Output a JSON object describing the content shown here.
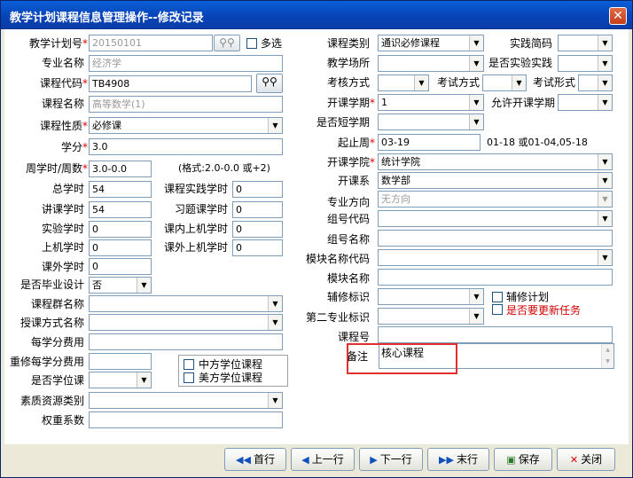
{
  "window": {
    "title": "教学计划课程信息管理操作--修改记录",
    "close": "✕"
  },
  "left": {
    "jxjhh": {
      "label": "教学计划号",
      "value": "20150101"
    },
    "duoxuan": "多选",
    "zymc": {
      "label": "专业名称",
      "value": "经济学"
    },
    "kcdm": {
      "label": "课程代码",
      "value": "TB4908"
    },
    "kcmc": {
      "label": "课程名称",
      "value": "高等数学(1)"
    },
    "kcxz": {
      "label": "课程性质",
      "value": "必修课"
    },
    "xf": {
      "label": "学分",
      "value": "3.0"
    },
    "zxs": {
      "label": "周学时/周数",
      "value": "3.0-0.0",
      "hint": "(格式:2.0-0.0 或+2)"
    },
    "zongxs": {
      "label": "总学时",
      "value": "54"
    },
    "kcsjxs": {
      "label": "课程实践学时",
      "value": "0"
    },
    "jkxs": {
      "label": "讲课学时",
      "value": "54"
    },
    "xtkxs": {
      "label": "习题课学时",
      "value": "0"
    },
    "syxs": {
      "label": "实验学时",
      "value": "0"
    },
    "knsjxs": {
      "label": "课内上机学时",
      "value": "0"
    },
    "sjxs": {
      "label": "上机学时",
      "value": "0"
    },
    "kwsjxs": {
      "label": "课外上机学时",
      "value": "0"
    },
    "kwxs": {
      "label": "课外学时",
      "value": "0"
    },
    "sfbysj": {
      "label": "是否毕业设计",
      "value": "否"
    },
    "kcqmc": {
      "label": "课程群名称",
      "value": ""
    },
    "skfsmc": {
      "label": "授课方式名称",
      "value": ""
    },
    "mxffy": {
      "label": "每学分费用",
      "value": ""
    },
    "cxmxffy": {
      "label": "重修每学分费用",
      "value": ""
    },
    "sfxwk": {
      "label": "是否学位课",
      "value": ""
    },
    "zfxwkc": "中方学位课程",
    "mfxwkc": "美方学位课程",
    "szzylb": {
      "label": "素质资源类别",
      "value": ""
    },
    "qzxs": {
      "label": "权重系数",
      "value": ""
    }
  },
  "right": {
    "kclb": {
      "label": "课程类别",
      "value": "通识必修课程"
    },
    "sjjc": {
      "label": "实践简码",
      "value": ""
    },
    "jxcs": {
      "label": "教学场所",
      "value": ""
    },
    "sfsysj": {
      "label": "是否实验实践",
      "value": ""
    },
    "khfs": {
      "label": "考核方式",
      "value": ""
    },
    "ksfs": {
      "label": "考试方式",
      "value": ""
    },
    "ksxs": {
      "label": "考试形式",
      "value": ""
    },
    "kkxq": {
      "label": "开课学期",
      "value": "1"
    },
    "yxkkxq": {
      "label": "允许开课学期",
      "value": ""
    },
    "sfdxq": {
      "label": "是否短学期",
      "value": ""
    },
    "qzz": {
      "label": "起止周",
      "value": "03-19",
      "hint": "01-18 或01-04,05-18"
    },
    "kkxy": {
      "label": "开课学院",
      "value": "统计学院"
    },
    "kkx": {
      "label": "开课系",
      "value": "数学部"
    },
    "zyfx": {
      "label": "专业方向",
      "value": "无方向"
    },
    "zhdm": {
      "label": "组号代码",
      "value": ""
    },
    "zhmc": {
      "label": "组号名称",
      "value": ""
    },
    "mkmcdm": {
      "label": "模块名称代码",
      "value": ""
    },
    "mkmc": {
      "label": "模块名称",
      "value": ""
    },
    "fxbs": {
      "label": "辅修标识",
      "value": ""
    },
    "fxjh": "辅修计划",
    "dezybs": {
      "label": "第二专业标识",
      "value": ""
    },
    "sfyyxrw": "是否要更新任务",
    "kch": {
      "label": "课程号",
      "value": ""
    },
    "bz": {
      "label": "备注",
      "value": "核心课程"
    }
  },
  "buttons": {
    "first": "首行",
    "prev": "上一行",
    "next": "下一行",
    "last": "末行",
    "save": "保存",
    "close": "关闭"
  },
  "icons": {
    "binoculars": "binoculars-icon"
  }
}
